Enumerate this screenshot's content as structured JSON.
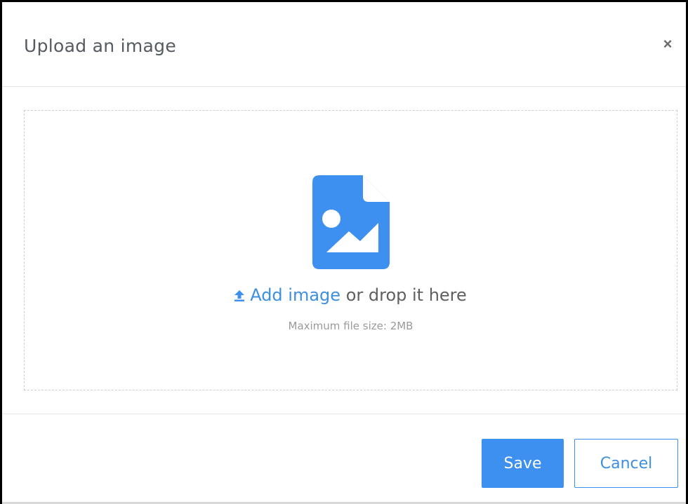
{
  "dialog": {
    "title": "Upload an image",
    "close_label": "×"
  },
  "dropzone": {
    "icon": "file-image-icon",
    "link_icon": "upload-arrow-icon",
    "add_link": "Add image",
    "drop_text": " or drop it here",
    "max_size": "Maximum file size: 2MB"
  },
  "footer": {
    "save_label": "Save",
    "cancel_label": "Cancel"
  },
  "colors": {
    "accent": "#3d8ff0",
    "title_text": "#555b61",
    "muted_text": "#9a9a9a",
    "border": "#e6e6e6"
  }
}
